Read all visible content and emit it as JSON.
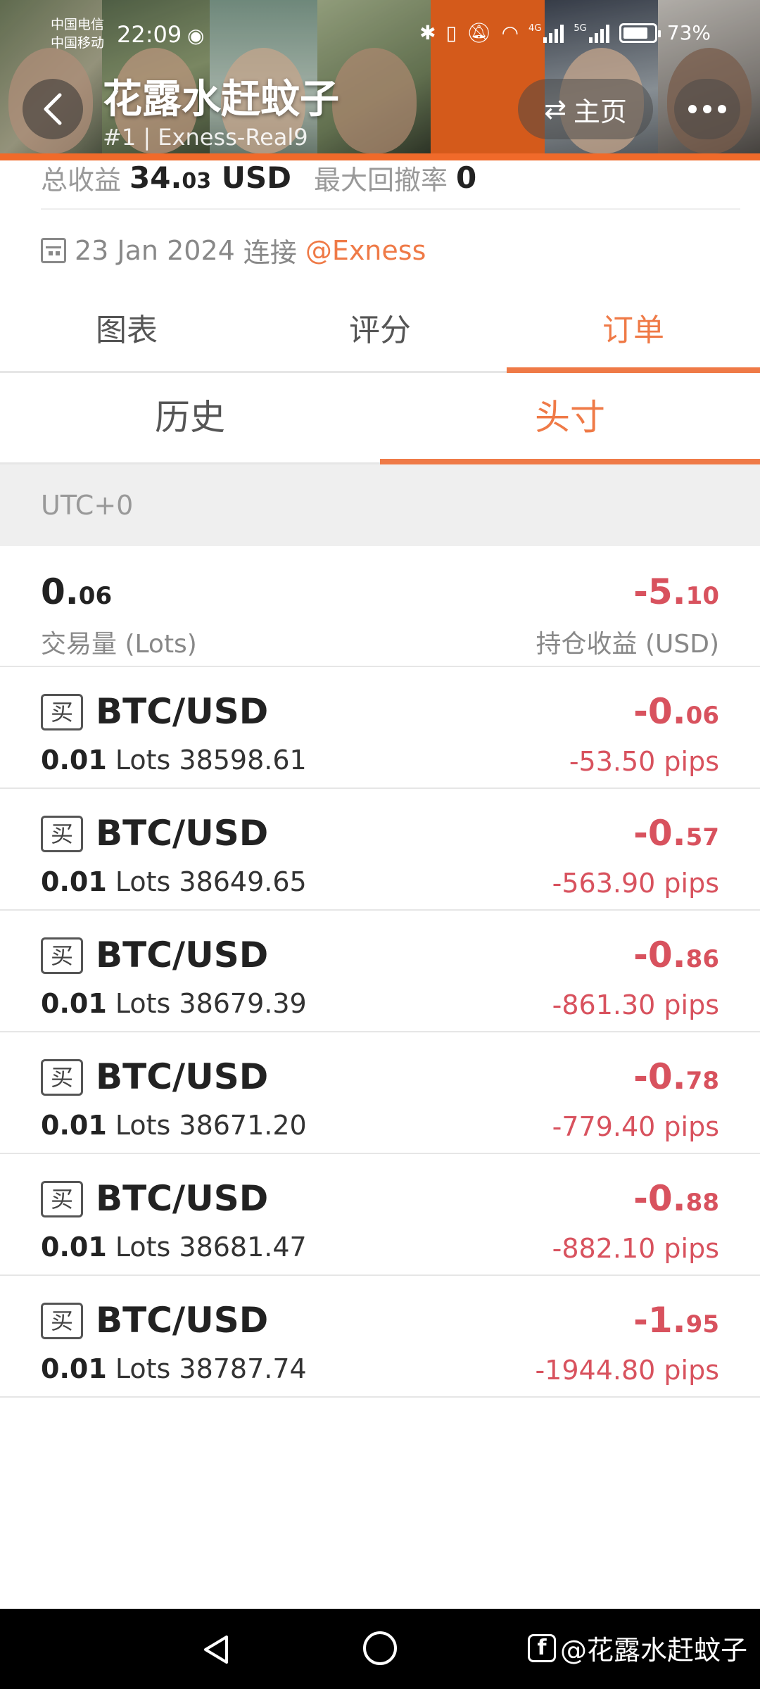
{
  "status_bar": {
    "carrier_1": "中国电信",
    "carrier_2": "中国移动",
    "time": "22:09",
    "signal_1": "4G",
    "signal_2": "5G",
    "battery": "73%"
  },
  "header": {
    "nickname": "花露水赶蚊子",
    "subtitle": "#1 | Exness-Real9",
    "home_label": "主页",
    "accent_color": "#f06a2a"
  },
  "summary": {
    "total_profit_label": "总收益",
    "total_profit_int": "34.",
    "total_profit_dec": "03",
    "total_profit_unit": "USD",
    "max_drawdown_label": "最大回撤率",
    "max_drawdown_value": "0"
  },
  "connection": {
    "date": "23 Jan 2024",
    "text": "连接",
    "broker": "@Exness"
  },
  "main_tabs": [
    {
      "label": "图表"
    },
    {
      "label": "评分"
    },
    {
      "label": "订单",
      "active": true
    }
  ],
  "order_tabs": [
    {
      "label": "历史"
    },
    {
      "label": "头寸",
      "active": true
    }
  ],
  "timezone": "UTC+0",
  "totals": {
    "lots_int": "0.",
    "lots_dec": "06",
    "lots_label": "交易量 (Lots)",
    "pl_int": "-5.",
    "pl_dec": "10",
    "pl_label": "持仓收益 (USD)"
  },
  "positions": [
    {
      "side": "买",
      "symbol": "BTC/USD",
      "lots": "0.01",
      "lots_unit": "Lots",
      "price": "38598.61",
      "pl_int": "-0.",
      "pl_dec": "06",
      "pips": "-53.50 pips"
    },
    {
      "side": "买",
      "symbol": "BTC/USD",
      "lots": "0.01",
      "lots_unit": "Lots",
      "price": "38649.65",
      "pl_int": "-0.",
      "pl_dec": "57",
      "pips": "-563.90 pips"
    },
    {
      "side": "买",
      "symbol": "BTC/USD",
      "lots": "0.01",
      "lots_unit": "Lots",
      "price": "38679.39",
      "pl_int": "-0.",
      "pl_dec": "86",
      "pips": "-861.30 pips"
    },
    {
      "side": "买",
      "symbol": "BTC/USD",
      "lots": "0.01",
      "lots_unit": "Lots",
      "price": "38671.20",
      "pl_int": "-0.",
      "pl_dec": "78",
      "pips": "-779.40 pips"
    },
    {
      "side": "买",
      "symbol": "BTC/USD",
      "lots": "0.01",
      "lots_unit": "Lots",
      "price": "38681.47",
      "pl_int": "-0.",
      "pl_dec": "88",
      "pips": "-882.10 pips"
    },
    {
      "side": "买",
      "symbol": "BTC/USD",
      "lots": "0.01",
      "lots_unit": "Lots",
      "price": "38787.74",
      "pl_int": "-1.",
      "pl_dec": "95",
      "pips": "-1944.80 pips"
    }
  ],
  "watermark": {
    "text": "@花露水赶蚊子",
    "icon": "facebook-icon"
  },
  "colors": {
    "accent": "#ef7a47",
    "loss": "#d8525e"
  }
}
